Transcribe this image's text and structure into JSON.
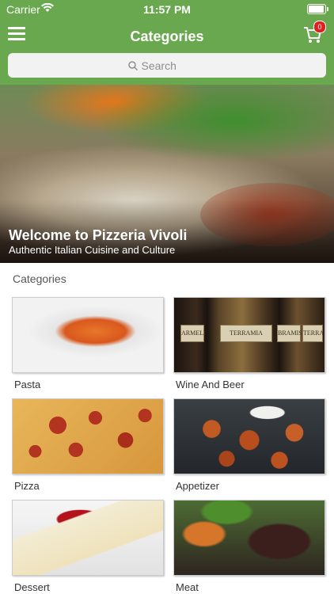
{
  "status_bar": {
    "carrier": "Carrier",
    "time": "11:57 PM"
  },
  "nav": {
    "title": "Categories",
    "cart_count": "0"
  },
  "search": {
    "placeholder": "Search"
  },
  "hero": {
    "title": "Welcome to Pizzeria Vivoli",
    "subtitle": "Authentic Italian Cuisine and Culture"
  },
  "categories": {
    "section_label": "Categories",
    "items": [
      {
        "label": "Pasta"
      },
      {
        "label": "Wine And Beer",
        "bottle_labels": [
          "ARMELI",
          "TERRAMIA",
          "BRAMIS",
          "TERRA"
        ]
      },
      {
        "label": "Pizza"
      },
      {
        "label": "Appetizer"
      },
      {
        "label": "Dessert"
      },
      {
        "label": "Meat"
      }
    ]
  },
  "colors": {
    "header_green": "#6aa84f",
    "badge_red": "#e02020"
  }
}
